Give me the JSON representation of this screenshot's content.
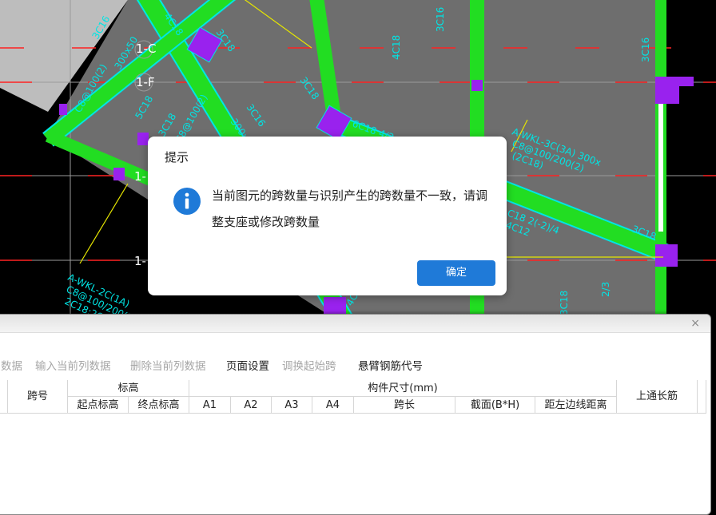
{
  "cad": {
    "labels": {
      "axis_1f": "1-F",
      "axis_1c": "1-C",
      "axis_1a": "1-",
      "axis_1b": "1-",
      "l1": "3C16",
      "l2": "C8@100(2)",
      "l3": "300x50",
      "l4": "5C18",
      "l5": "3C18",
      "l6": "3C16",
      "l7": "300x500",
      "l8": "3C18",
      "l9": "6C18 4/2",
      "l10": "3C18",
      "l11": "C8@100(2)",
      "l12": "A-WKL-2C(1A)",
      "l13": "C8@100/200(2)",
      "l14": "2C18;2C22",
      "l15": "C18 2(-2)/4",
      "l16": "4C12",
      "l17": "3C18",
      "l18": "3C16",
      "l19": "4C18",
      "l20": "4C18",
      "l21": "2/3",
      "l22": "3C16",
      "l23": "4C18",
      "l24": "3C18",
      "l25": "A-WKL-3C(3A) 300x",
      "l26": "C8@100/200(2)",
      "l27": "(2C18)"
    }
  },
  "dialog": {
    "title": "提示",
    "message": "当前图元的跨数量与识别产生的跨数量不一致，请调整支座或修改跨数量",
    "ok_label": "确定"
  },
  "panel": {
    "close_label": "×",
    "toolbar": [
      {
        "label": "数据",
        "enabled": false
      },
      {
        "label": "输入当前列数据",
        "enabled": false
      },
      {
        "label": "删除当前列数据",
        "enabled": false
      },
      {
        "label": "页面设置",
        "enabled": true
      },
      {
        "label": "调换起始跨",
        "enabled": false
      },
      {
        "label": "悬臂钢筋代号",
        "enabled": true
      }
    ],
    "table": {
      "span_no": "跨号",
      "elevation": "标高",
      "start_elev": "起点标高",
      "end_elev": "终点标高",
      "size_group": "构件尺寸(mm)",
      "a1": "A1",
      "a2": "A2",
      "a3": "A3",
      "a4": "A4",
      "span_len": "跨长",
      "section": "截面(B*H)",
      "dist_left": "距左边线距离",
      "top_through": "上通长筋"
    }
  },
  "colors": {
    "beam": "#22dd22",
    "beam_edge": "#00e5e5",
    "column": "#9922ee",
    "axis": "#ff2222",
    "grey_fill": "#6e6e6e",
    "accent_button": "#1f7ad8"
  }
}
